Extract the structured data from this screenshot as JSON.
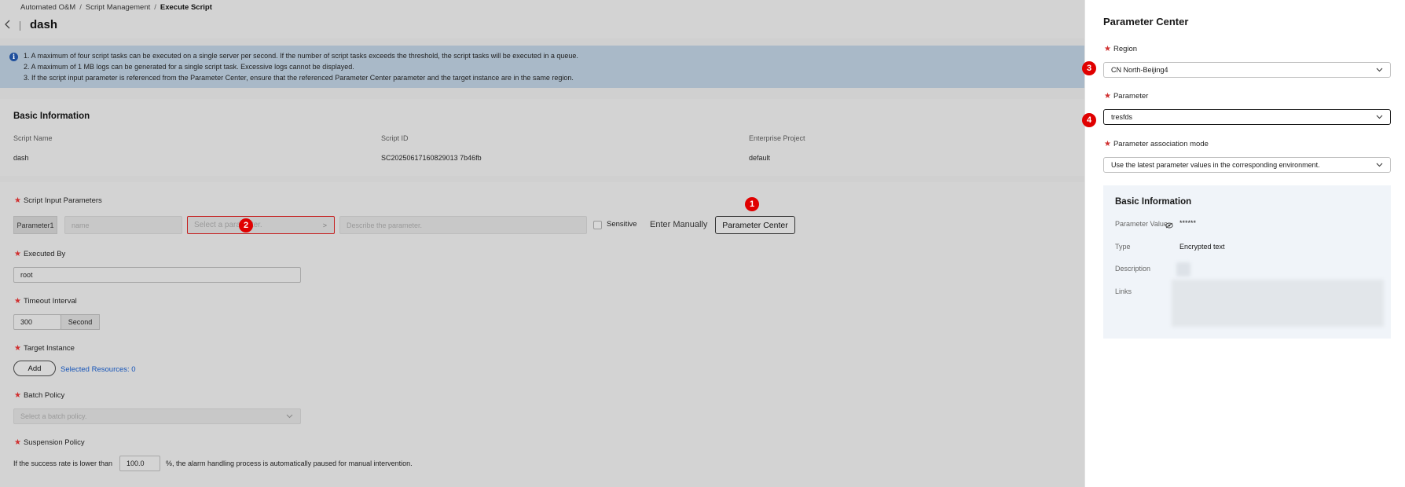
{
  "breadcrumb": {
    "item1": "Automated O&M",
    "item2": "Script Management",
    "current": "Execute Script",
    "separator": "/"
  },
  "page": {
    "title": "dash",
    "back_icon": "back-arrow-icon"
  },
  "notice": {
    "icon": "info-icon",
    "line1": "1. A maximum of four script tasks can be executed on a single server per second. If the number of script tasks exceeds the threshold, the script tasks will be executed in a queue.",
    "line2": "2. A maximum of 1 MB logs can be generated for a single script task. Excessive logs cannot be displayed.",
    "line3": "3. If the script input parameter is referenced from the Parameter Center, ensure that the referenced Parameter Center parameter and the target instance are in the same region."
  },
  "basic_info": {
    "title": "Basic Information",
    "script_name_label": "Script Name",
    "script_name": "dash",
    "script_id_label": "Script ID",
    "script_id": "SC20250617160829013 7b46fb",
    "enterprise_project_label": "Enterprise Project",
    "enterprise_project": "default"
  },
  "form": {
    "required_mark": "★",
    "input_params_label": "Script Input Parameters",
    "param_tag": "Parameter1",
    "name_placeholder": "name",
    "select_param_placeholder": "Select a parameter.",
    "select_param_arrow": ">",
    "describe_placeholder": "Describe the parameter.",
    "sensitive_label": "Sensitive",
    "enter_manually": "Enter Manually",
    "parameter_center_button": "Parameter Center",
    "executed_by_label": "Executed By",
    "executed_by_value": "root",
    "timeout_label": "Timeout Interval",
    "timeout_value": "300",
    "timeout_unit": "Second",
    "target_instance_label": "Target Instance",
    "add_button": "Add",
    "selected_resources": "Selected Resources: 0",
    "batch_policy_label": "Batch Policy",
    "batch_policy_placeholder": "Select a batch policy.",
    "suspension_label": "Suspension Policy",
    "suspension_prefix": "If the success rate is lower than",
    "suspension_value": "100.0",
    "suspension_suffix": "%, the alarm handling process is automatically paused for manual intervention."
  },
  "markers": {
    "m1": "1",
    "m2": "2",
    "m3": "3",
    "m4": "4"
  },
  "drawer": {
    "title": "Parameter Center",
    "region_label": "Region",
    "region_value": "CN North-Beijing4",
    "parameter_label": "Parameter",
    "parameter_value": "tresfds",
    "mode_label": "Parameter association mode",
    "mode_value": "Use the latest parameter values in the corresponding environment.",
    "info": {
      "title": "Basic Information",
      "value_label": "Parameter Value",
      "value": "******",
      "type_label": "Type",
      "type_value": "Encrypted text",
      "description_label": "Description",
      "links_label": "Links"
    }
  },
  "colors": {
    "accent_red": "#e00000",
    "link_blue": "#1554b8",
    "notice_bg": "#a9b9c8",
    "panel_bg": "#f0f4f9"
  }
}
